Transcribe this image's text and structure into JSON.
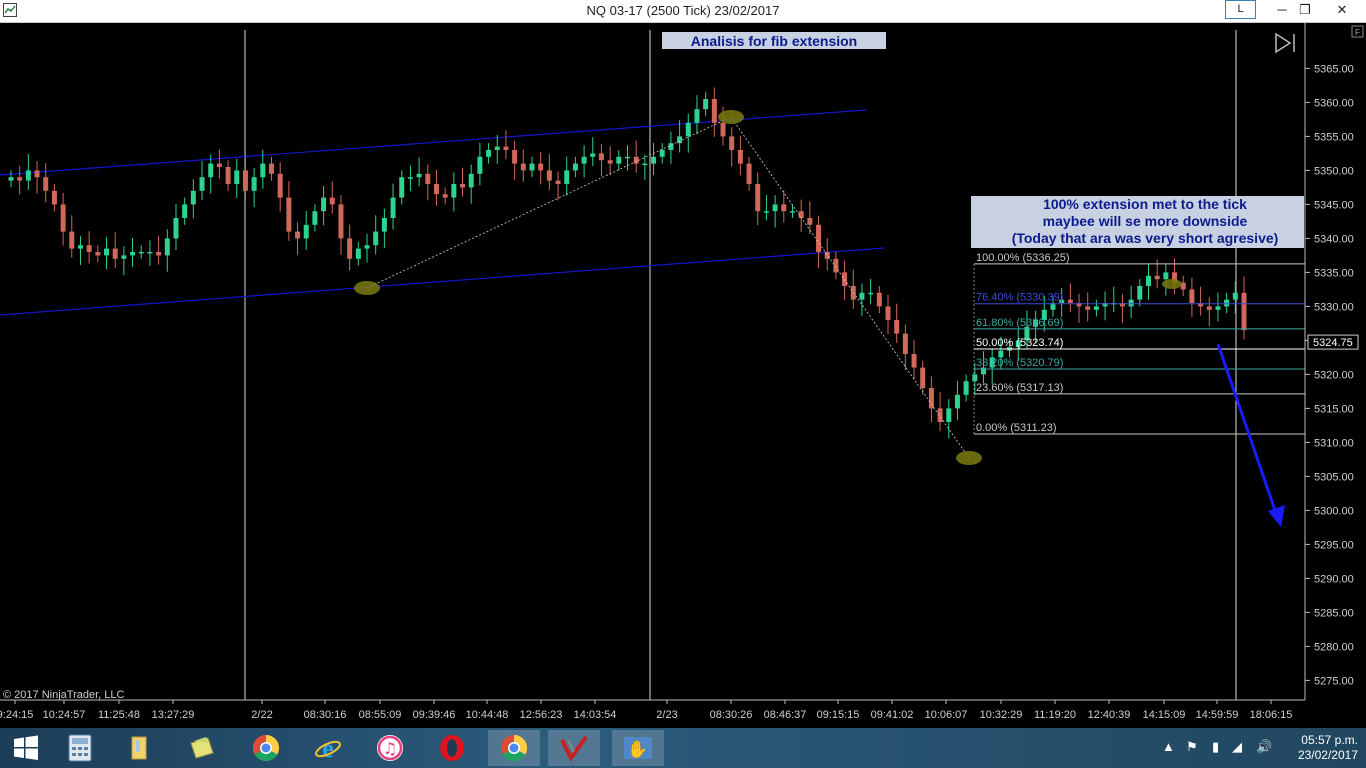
{
  "window": {
    "title": "NQ 03-17 (2500 Tick)  23/02/2017",
    "l_button": "L",
    "minimize": "─",
    "restore": "❐",
    "close": "✕"
  },
  "chart_data": {
    "type": "candlestick",
    "title": "Analisis for fib extension",
    "ylabel": "",
    "ylim": [
      5271,
      5370
    ],
    "y_ticks": [
      5365,
      5360,
      5355,
      5350,
      5345,
      5340,
      5335,
      5330,
      5325,
      5320,
      5315,
      5310,
      5305,
      5300,
      5295,
      5290,
      5285,
      5280,
      5275
    ],
    "x_tick_labels": [
      "9:24:15",
      "10:24:57",
      "11:25:48",
      "13:27:29",
      "2/22",
      "08:30:16",
      "08:55:09",
      "09:39:46",
      "10:44:48",
      "12:56:23",
      "14:03:54",
      "2/23",
      "08:30:26",
      "08:46:37",
      "09:15:15",
      "09:41:02",
      "10:06:07",
      "10:32:29",
      "11:19:20",
      "12:40:39",
      "14:15:09",
      "14:59:59",
      "18:06:15"
    ],
    "session_separators": [
      "2/22",
      "2/23",
      "end"
    ],
    "current_price": "5324.75",
    "copyright": "© 2017 NinjaTrader, LLC",
    "colors": {
      "up": "#2ed38f",
      "down": "#d0695a",
      "channel": "#1515d0",
      "fib": "#ffffff",
      "marker": "#7a7a10",
      "annotation_bg": "#c7d1e2",
      "annotation_text": "#0d1b8c",
      "arrow": "#1a1aff"
    },
    "annotation": {
      "line1": "100% extension met to the tick",
      "line2": "maybee  will se more downside",
      "line3": "(Today that ara was very short agresive)"
    },
    "fib_levels": [
      {
        "label": "100.00% (5336.25)",
        "price": 5336.25,
        "color": "#c8c8c8"
      },
      {
        "label": "76.40% (5330.39)",
        "price": 5330.39,
        "color": "#3a4bd8"
      },
      {
        "label": "61.80% (5326.69)",
        "price": 5326.69,
        "color": "#3aa8a0"
      },
      {
        "label": "50.00% (5323.74)",
        "price": 5323.74,
        "color": "#ffffff"
      },
      {
        "label": "38.20% (5320.79)",
        "price": 5320.79,
        "color": "#3aa8a0"
      },
      {
        "label": "23.60% (5317.13)",
        "price": 5317.13,
        "color": "#c8c8c8"
      },
      {
        "label": "0.00% (5311.23)",
        "price": 5311.23,
        "color": "#c8c8c8"
      }
    ],
    "pivot_markers": [
      {
        "time": "08:55:09",
        "price": 5335.8
      },
      {
        "time": "08:30:26",
        "price": 5361.2
      },
      {
        "time": "10:06:07",
        "price": 5310.5
      },
      {
        "time": "14:15:09",
        "price": 5336.2
      }
    ],
    "closes": [
      5349,
      5348.5,
      5350,
      5349,
      5347,
      5345,
      5341,
      5338.5,
      5339,
      5338,
      5337.5,
      5338.5,
      5337,
      5337.5,
      5338,
      5338,
      5338,
      5337.5,
      5340,
      5343,
      5345,
      5347,
      5349,
      5351,
      5350.5,
      5348,
      5350,
      5347,
      5349,
      5351,
      5349.5,
      5346,
      5341,
      5340,
      5342,
      5344,
      5346,
      5345,
      5340,
      5337,
      5338.5,
      5339,
      5341,
      5343,
      5346,
      5349,
      5349,
      5349.5,
      5348,
      5346.5,
      5346,
      5348,
      5347.5,
      5349.5,
      5352,
      5353,
      5353.5,
      5353,
      5351,
      5350,
      5351,
      5350,
      5348.5,
      5348,
      5350,
      5351,
      5352,
      5352.5,
      5351.5,
      5351,
      5352,
      5352,
      5351,
      5351,
      5352,
      5353,
      5354,
      5355,
      5357,
      5359,
      5360.5,
      5357,
      5355,
      5353,
      5351,
      5348,
      5344,
      5344,
      5345,
      5344,
      5344,
      5343,
      5342,
      5338,
      5337,
      5335,
      5333,
      5331,
      5332,
      5332,
      5330,
      5328,
      5326,
      5323,
      5321,
      5318,
      5315,
      5313,
      5315,
      5317,
      5319,
      5320,
      5321,
      5322.5,
      5323.5,
      5324,
      5325,
      5327,
      5328,
      5329.5,
      5330.5,
      5331,
      5330.5,
      5330,
      5329.5,
      5330,
      5330.5,
      5330.5,
      5330,
      5331,
      5333,
      5334.5,
      5334,
      5335,
      5333.5,
      5332.5,
      5330.5,
      5330,
      5329.5,
      5330,
      5331,
      5332,
      5326.5
    ]
  }
}
